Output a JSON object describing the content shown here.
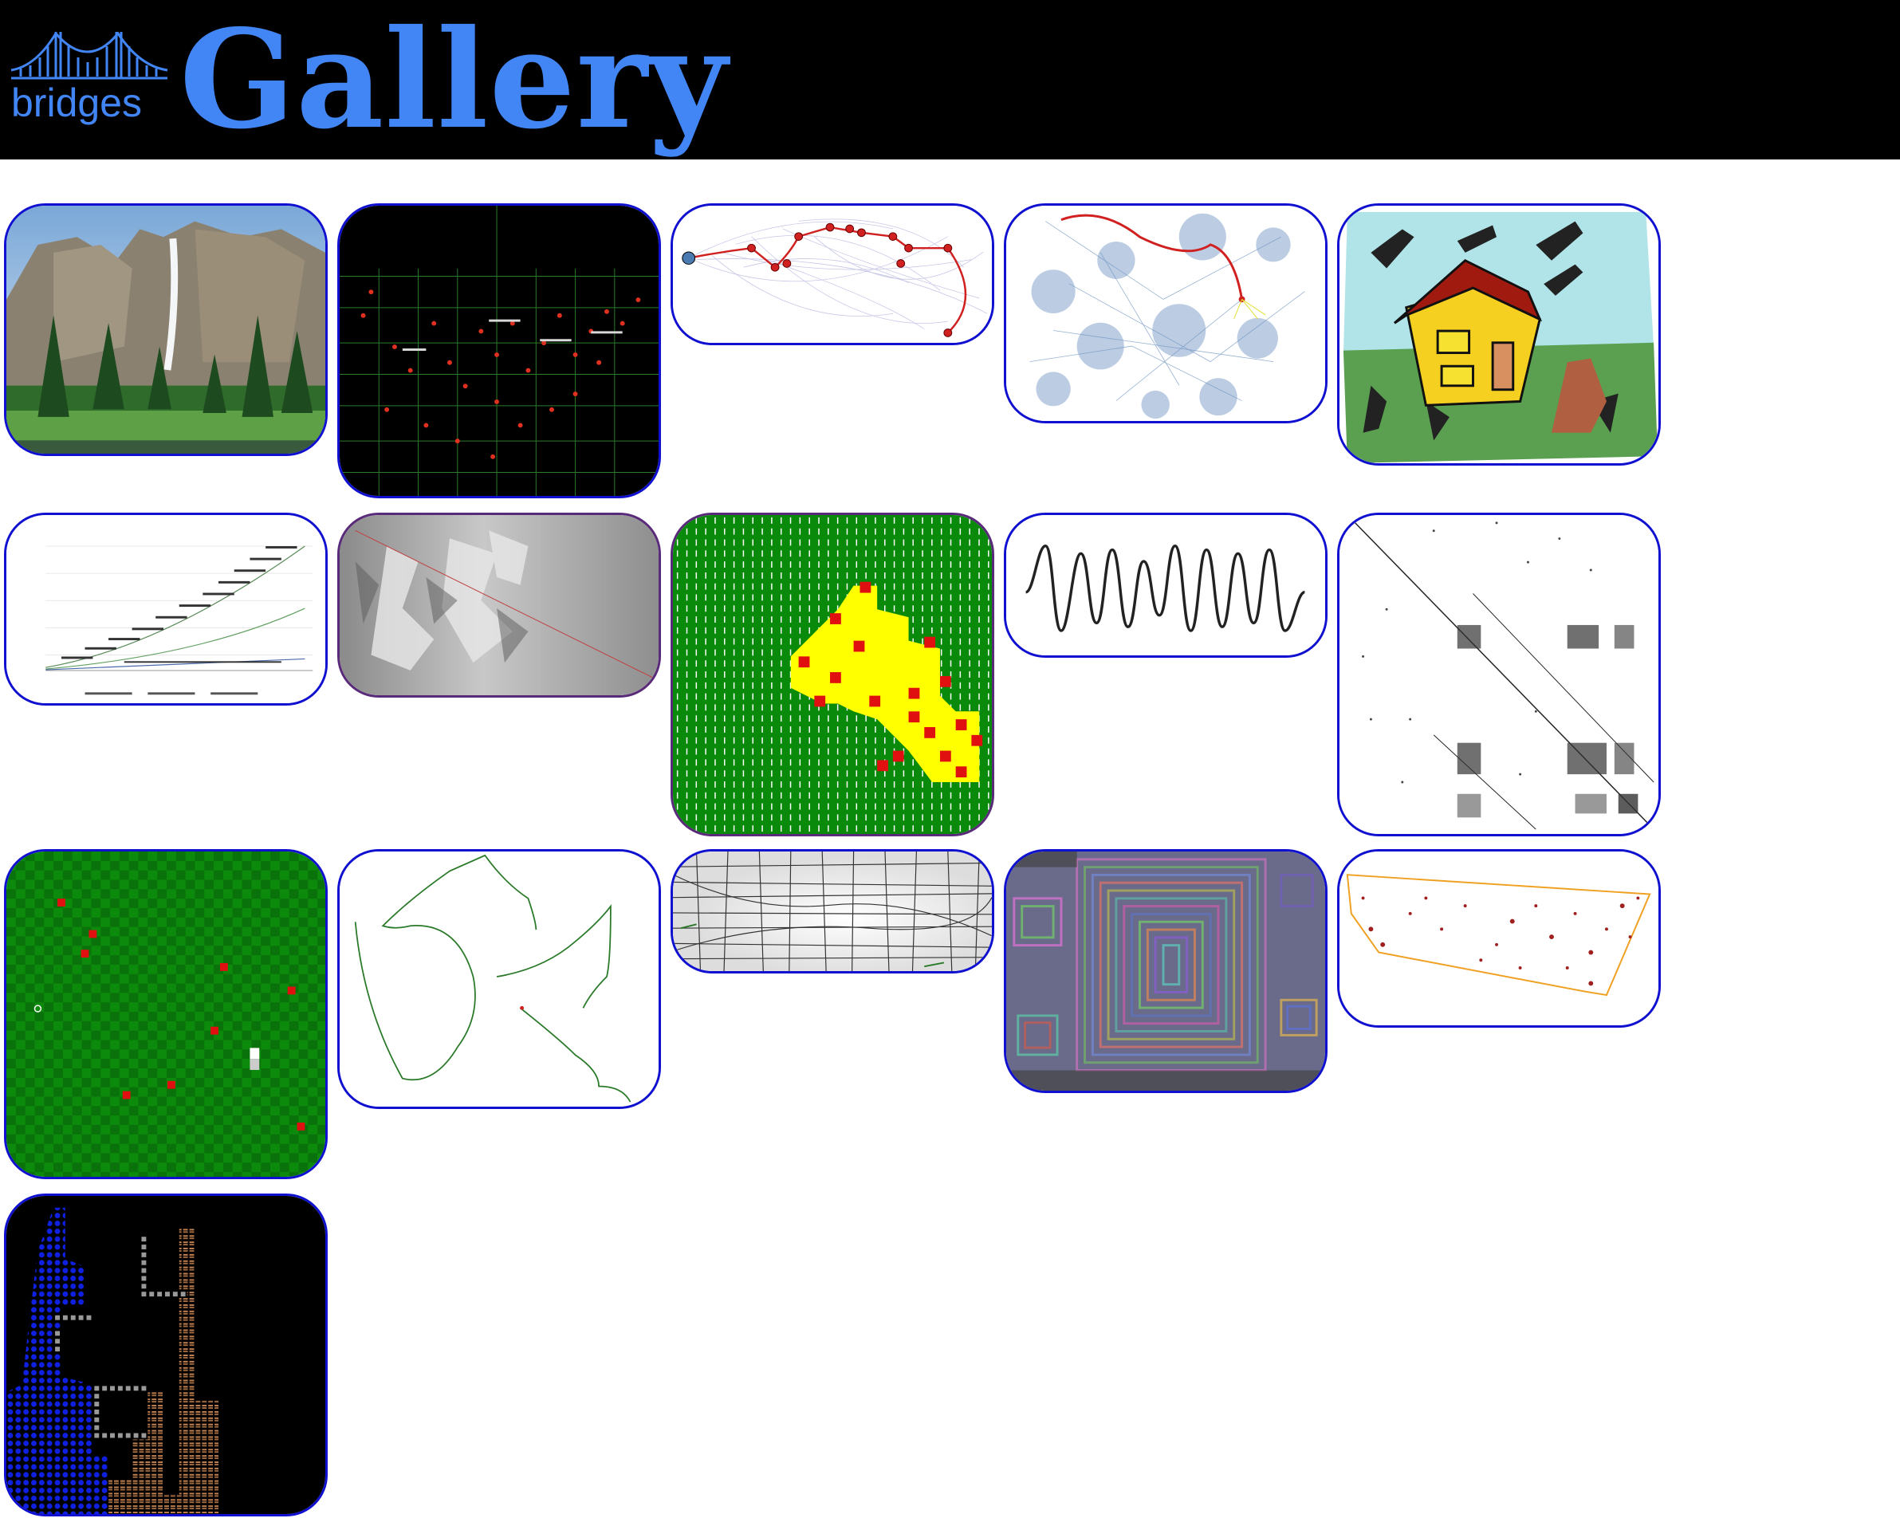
{
  "header": {
    "logo_text": "bridges",
    "title": "Gallery"
  },
  "colors": {
    "header_bg": "#000000",
    "title": "#4285f4",
    "tile_border": "#1010d0",
    "tile_border_alt": "#5a2a7a"
  },
  "gallery": {
    "tiles": [
      {
        "name": "yosemite-waterfall-image",
        "icon": "landscape-photo"
      },
      {
        "name": "us-city-map-night",
        "icon": "city-map"
      },
      {
        "name": "shortest-path-graph",
        "icon": "graph"
      },
      {
        "name": "network-cluster-graph",
        "icon": "network"
      },
      {
        "name": "house-drawing",
        "icon": "drawing"
      },
      {
        "name": "sorting-runtime-chart",
        "icon": "line-chart"
      },
      {
        "name": "elevation-map",
        "icon": "elevation"
      },
      {
        "name": "minesweeper-grid",
        "icon": "grid-game"
      },
      {
        "name": "audio-waveform",
        "icon": "waveform"
      },
      {
        "name": "sparse-matrix-plot",
        "icon": "matrix"
      },
      {
        "name": "snake-game-grid",
        "icon": "game-board"
      },
      {
        "name": "fractal-curve",
        "icon": "curve"
      },
      {
        "name": "osm-road-network",
        "icon": "road-map"
      },
      {
        "name": "nested-squares-art",
        "icon": "squares"
      },
      {
        "name": "convex-hull-cities",
        "icon": "convex-hull"
      },
      {
        "name": "falling-sand-game",
        "icon": "pixel-game"
      }
    ]
  }
}
